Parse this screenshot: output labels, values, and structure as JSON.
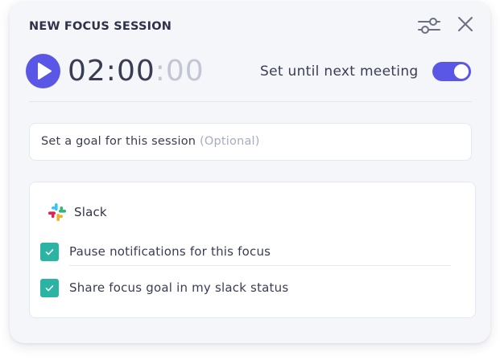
{
  "header": {
    "title": "NEW FOCUS SESSION",
    "settings_icon": "sliders-icon",
    "close_icon": "close-icon"
  },
  "timer": {
    "play_icon": "play-icon",
    "main": "02:00",
    "seconds": ":00"
  },
  "until_next_meeting": {
    "label": "Set until next meeting",
    "enabled": true
  },
  "goal_input": {
    "placeholder": "Set a goal for this session",
    "optional_hint": "(Optional)",
    "value": ""
  },
  "slack": {
    "name": "Slack",
    "logo_icon": "slack-logo-icon",
    "options": [
      {
        "label": "Pause notifications for this focus",
        "checked": true
      },
      {
        "label": "Share focus goal in my slack status",
        "checked": true
      }
    ]
  },
  "colors": {
    "accent": "#5b57e6",
    "check": "#2bb3a3",
    "panel_bg": "#f5f6fa",
    "text": "#3a3d52",
    "muted": "#a7abc2"
  }
}
